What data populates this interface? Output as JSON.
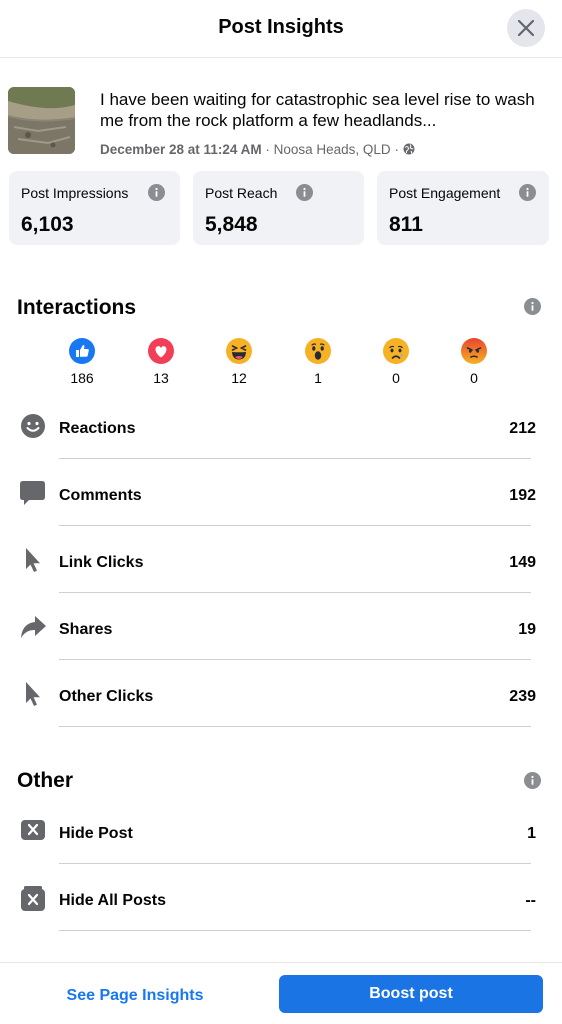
{
  "header": {
    "title": "Post Insights"
  },
  "post": {
    "text": "I have been waiting for catastrophic sea level rise to wash me from the rock platform a few headlands...",
    "date": "December 28 at 11:24 AM",
    "location": "Noosa Heads, QLD",
    "separator": "·",
    "privacy_icon": "globe-icon"
  },
  "stats": [
    {
      "label": "Post Impressions",
      "value": "6,103"
    },
    {
      "label": "Post Reach",
      "value": "5,848"
    },
    {
      "label": "Post Engagement",
      "value": "811"
    }
  ],
  "interactions": {
    "title": "Interactions",
    "reactions": [
      {
        "name": "like",
        "count": "186"
      },
      {
        "name": "love",
        "count": "13"
      },
      {
        "name": "haha",
        "count": "12"
      },
      {
        "name": "wow",
        "count": "1"
      },
      {
        "name": "sad",
        "count": "0"
      },
      {
        "name": "angry",
        "count": "0"
      }
    ],
    "metrics": [
      {
        "icon": "smiley-icon",
        "label": "Reactions",
        "value": "212"
      },
      {
        "icon": "comment-icon",
        "label": "Comments",
        "value": "192"
      },
      {
        "icon": "cursor-icon",
        "label": "Link Clicks",
        "value": "149"
      },
      {
        "icon": "share-icon",
        "label": "Shares",
        "value": "19"
      },
      {
        "icon": "cursor-icon",
        "label": "Other Clicks",
        "value": "239"
      }
    ]
  },
  "other": {
    "title": "Other",
    "metrics": [
      {
        "icon": "hide-post-icon",
        "label": "Hide Post",
        "value": "1"
      },
      {
        "icon": "hide-all-posts-icon",
        "label": "Hide All Posts",
        "value": "--"
      }
    ]
  },
  "footer": {
    "see_insights_label": "See Page Insights",
    "boost_label": "Boost post"
  },
  "colors": {
    "accent": "#1877f2",
    "button": "#1b74e4",
    "card_bg": "#f0f2f5",
    "secondary_text": "#65676b"
  }
}
